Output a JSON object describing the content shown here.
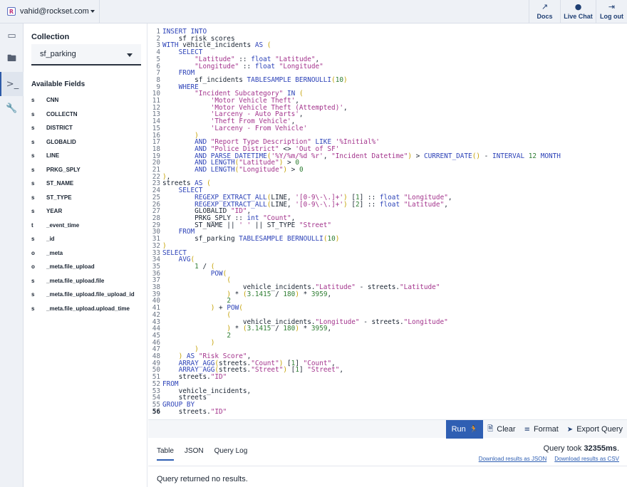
{
  "account": {
    "email": "vahid@rockset.com",
    "logo_letter": "R"
  },
  "topnav": [
    {
      "label": "Docs",
      "icon": "external-link-icon"
    },
    {
      "label": "Live Chat",
      "icon": "chat-bubble-icon"
    },
    {
      "label": "Log out",
      "icon": "logout-icon"
    }
  ],
  "rail": [
    "monitor-icon",
    "folder-icon",
    "terminal-icon",
    "wrench-icon"
  ],
  "sidebar": {
    "collection_title": "Collection",
    "collection_value": "sf_parking",
    "fields_title": "Available Fields",
    "fields": [
      {
        "type": "s",
        "name": "CNN"
      },
      {
        "type": "s",
        "name": "COLLECTN"
      },
      {
        "type": "s",
        "name": "DISTRICT"
      },
      {
        "type": "s",
        "name": "GLOBALID"
      },
      {
        "type": "s",
        "name": "LINE"
      },
      {
        "type": "s",
        "name": "PRKG_SPLY"
      },
      {
        "type": "s",
        "name": "ST_NAME"
      },
      {
        "type": "s",
        "name": "ST_TYPE"
      },
      {
        "type": "s",
        "name": "YEAR"
      },
      {
        "type": "t",
        "name": "_event_time"
      },
      {
        "type": "s",
        "name": "_id"
      },
      {
        "type": "o",
        "name": "_meta"
      },
      {
        "type": "o",
        "name": "_meta.file_upload"
      },
      {
        "type": "s",
        "name": "_meta.file_upload.file"
      },
      {
        "type": "s",
        "name": "_meta.file_upload.file_upload_id"
      },
      {
        "type": "s",
        "name": "_meta.file_upload.upload_time"
      }
    ]
  },
  "editor": {
    "current_line": 56,
    "lines": [
      "INSERT INTO",
      "    sf_risk_scores",
      "WITH vehicle_incidents AS (",
      "    SELECT",
      "        \"Latitude\" :: float \"Latitude\",",
      "        \"Longitude\" :: float \"Longitude\"",
      "    FROM",
      "        sf_incidents TABLESAMPLE BERNOULLI(10)",
      "    WHERE",
      "        \"Incident Subcategory\" IN (",
      "            'Motor Vehicle Theft',",
      "            'Motor Vehicle Theft (Attempted)',",
      "            'Larceny - Auto Parts',",
      "            'Theft From Vehicle',",
      "            'Larceny - From Vehicle'",
      "        )",
      "        AND \"Report Type Description\" LIKE '%Initial%'",
      "        AND \"Police District\" <> 'Out of SF'",
      "        AND PARSE_DATETIME('%Y/%m/%d %r', \"Incident Datetime\") > CURRENT_DATE() - INTERVAL 12 MONTH",
      "        AND LENGTH(\"Latitude\") > 0",
      "        AND LENGTH(\"Longitude\") > 0",
      "),",
      "streets AS (",
      "    SELECT",
      "        REGEXP_EXTRACT_ALL(LINE, '[0-9\\-\\.]+') [1] :: float \"Longitude\",",
      "        REGEXP_EXTRACT_ALL(LINE, '[0-9\\-\\.]+') [2] :: float \"Latitude\",",
      "        GLOBALID \"ID\",",
      "        PRKG_SPLY :: int \"Count\",",
      "        ST_NAME || ' ' || ST_TYPE \"Street\"",
      "    FROM",
      "        sf_parking TABLESAMPLE BERNOULLI(10)",
      ")",
      "SELECT",
      "    AVG(",
      "        1 / (",
      "            POW(",
      "                (",
      "                    vehicle_incidents.\"Latitude\" - streets.\"Latitude\"",
      "                ) * (3.1415 / 180) * 3959,",
      "                2",
      "            ) + POW(",
      "                (",
      "                    vehicle_incidents.\"Longitude\" - streets.\"Longitude\"",
      "                ) * (3.1415 / 180) * 3959,",
      "                2",
      "            )",
      "        )",
      "    ) AS \"Risk Score\",",
      "    ARRAY_AGG(streets.\"Count\") [1] \"Count\",",
      "    ARRAY_AGG(streets.\"Street\") [1] \"Street\",",
      "    streets.\"ID\"",
      "FROM",
      "    vehicle_incidents,",
      "    streets",
      "GROUP BY",
      "    streets.\"ID\""
    ]
  },
  "actions": {
    "run": "Run",
    "clear": "Clear",
    "format": "Format",
    "export": "Export Query",
    "run_icon": "running-person-icon",
    "clear_icon": "document-icon",
    "format_icon": "align-icon",
    "export_icon": "export-icon"
  },
  "results": {
    "tabs": [
      "Table",
      "JSON",
      "Query Log"
    ],
    "active_tab": "Table",
    "time_prefix": "Query took ",
    "time_value": "32355ms",
    "time_suffix": ".",
    "download_json": "Download results as JSON",
    "download_csv": "Download results as CSV",
    "empty_message": "Query returned no results."
  }
}
